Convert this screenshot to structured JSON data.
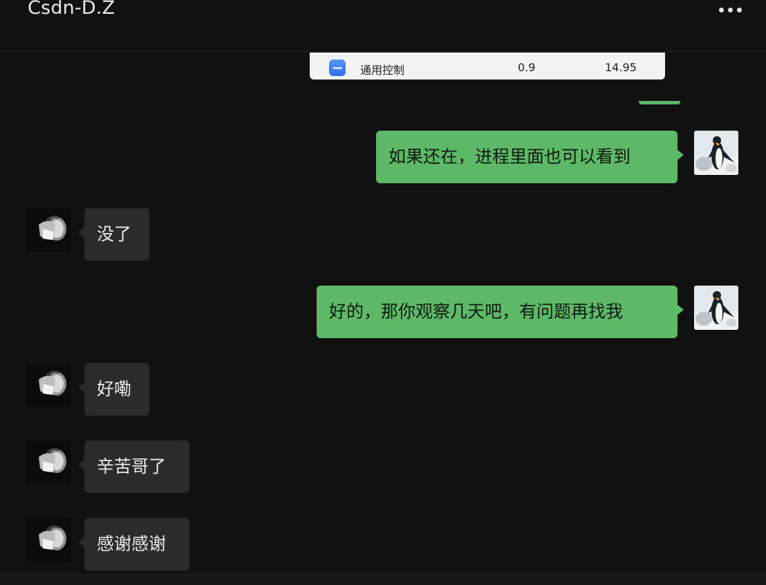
{
  "header": {
    "title": "Csdn-D.Z",
    "more_icon": "more-dots-icon"
  },
  "snippet": {
    "icon": "app-icon",
    "name": "通用控制",
    "value1": "0.9",
    "value2": "14.95"
  },
  "colors": {
    "background": "#111111",
    "outgoing_bubble": "#5db868",
    "incoming_bubble": "#2b2b2b"
  },
  "messages": [
    {
      "direction": "out",
      "text": "如果还在，进程里面也可以看到",
      "avatar": "penguin-avatar"
    },
    {
      "direction": "in",
      "text": "没了",
      "avatar": "contact-avatar"
    },
    {
      "direction": "out",
      "text": "好的，那你观察几天吧，有问题再找我",
      "avatar": "penguin-avatar"
    },
    {
      "direction": "in",
      "text": "好嘞",
      "avatar": "contact-avatar"
    },
    {
      "direction": "in",
      "text": "辛苦哥了",
      "avatar": "contact-avatar"
    },
    {
      "direction": "in",
      "text": "感谢感谢",
      "avatar": "contact-avatar"
    }
  ]
}
